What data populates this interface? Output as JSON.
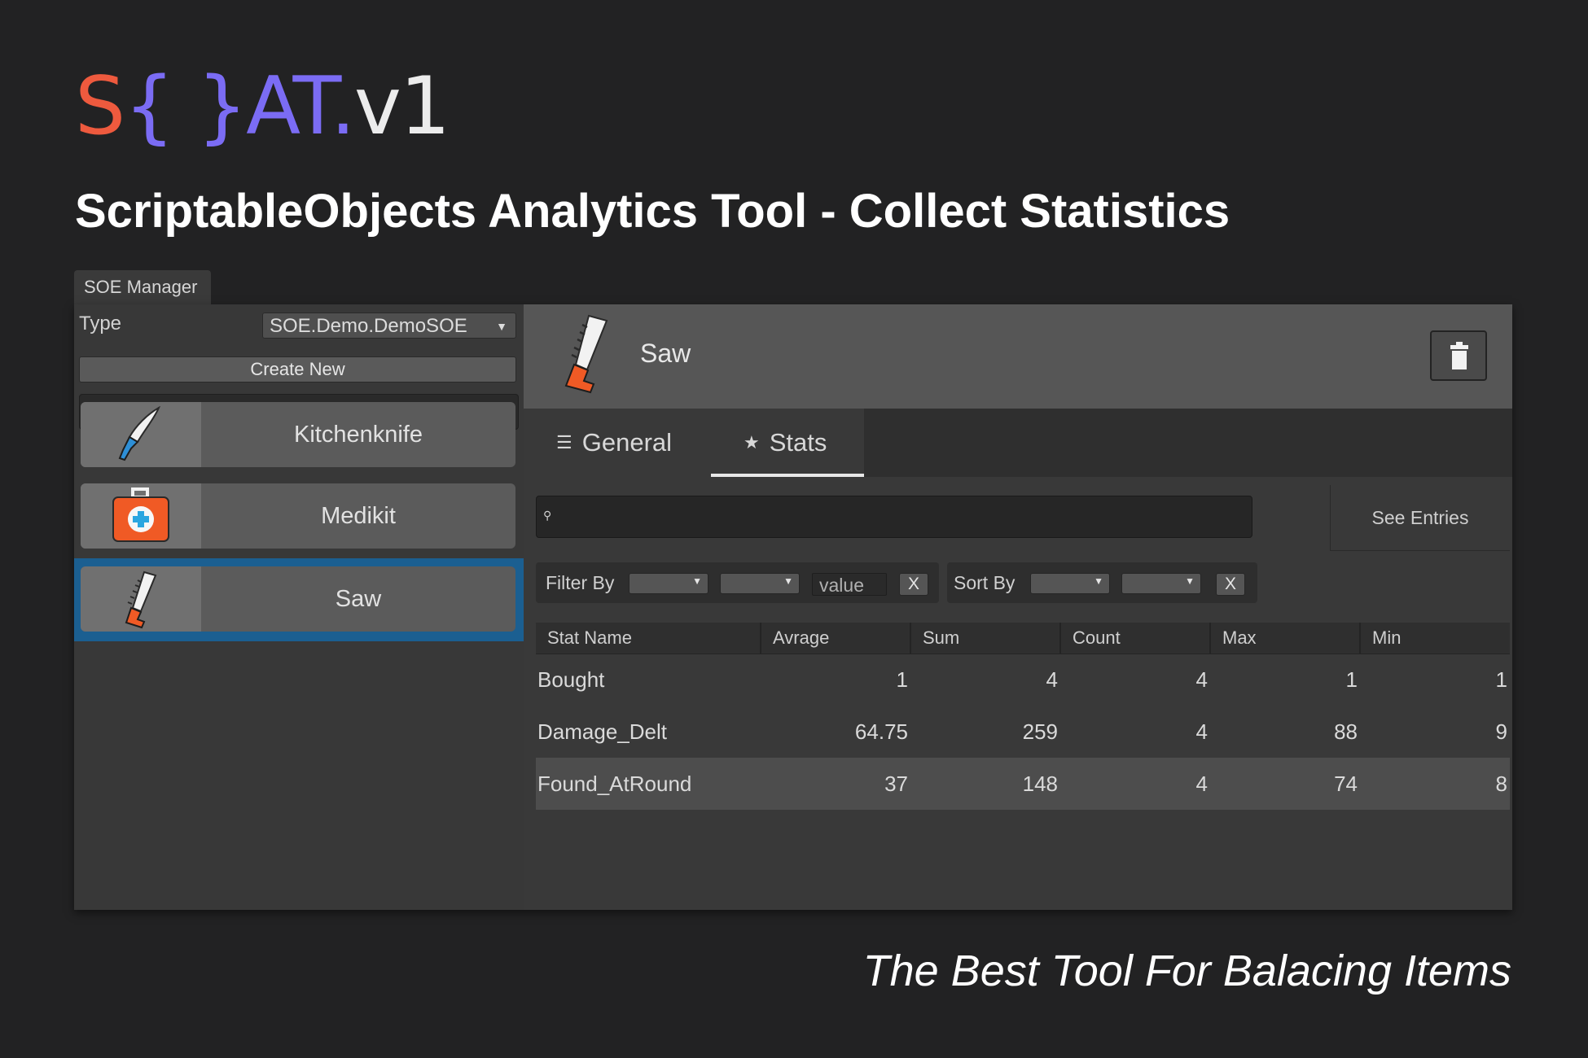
{
  "brand": {
    "logo_s": "S",
    "logo_braces": "{ }",
    "logo_at": "AT",
    "logo_dot": ".",
    "logo_version": "v1",
    "headline": "ScriptableObjects Analytics Tool - Collect Statistics",
    "tagline": "The Best Tool For Balacing Items",
    "colors": {
      "s": "#ee5a3e",
      "braces": "#7b6cf4",
      "version": "#ececec"
    }
  },
  "window": {
    "tab_title": "SOE Manager"
  },
  "left_panel": {
    "type_label": "Type",
    "type_value": "SOE.Demo.DemoSOE",
    "create_new_label": "Create New",
    "search_placeholder": "",
    "items": [
      {
        "name": "Kitchenknife",
        "icon": "knife-icon",
        "selected": false
      },
      {
        "name": "Medikit",
        "icon": "medkit-icon",
        "selected": false
      },
      {
        "name": "Saw",
        "icon": "saw-icon",
        "selected": true
      }
    ],
    "selected_color": "#1b5f91"
  },
  "detail": {
    "title": "Saw",
    "icon": "saw-icon",
    "delete_icon": "trash-icon",
    "tabs": [
      {
        "label": "General",
        "icon": "list-icon",
        "active": false
      },
      {
        "label": "Stats",
        "icon": "star-icon",
        "active": true
      }
    ],
    "search_placeholder": "",
    "see_entries_label": "See Entries",
    "filter": {
      "label": "Filter By",
      "value_placeholder": "value",
      "clear_label": "X"
    },
    "sort": {
      "label": "Sort By",
      "clear_label": "X"
    },
    "table": {
      "columns": [
        "Stat Name",
        "Avrage",
        "Sum",
        "Count",
        "Max",
        "Min"
      ],
      "rows": [
        {
          "name": "Bought",
          "avg": "1",
          "sum": "4",
          "count": "4",
          "max": "1",
          "min": "1"
        },
        {
          "name": "Damage_Delt",
          "avg": "64.75",
          "sum": "259",
          "count": "4",
          "max": "88",
          "min": "9"
        },
        {
          "name": "Found_AtRound",
          "avg": "37",
          "sum": "148",
          "count": "4",
          "max": "74",
          "min": "8"
        }
      ]
    }
  }
}
